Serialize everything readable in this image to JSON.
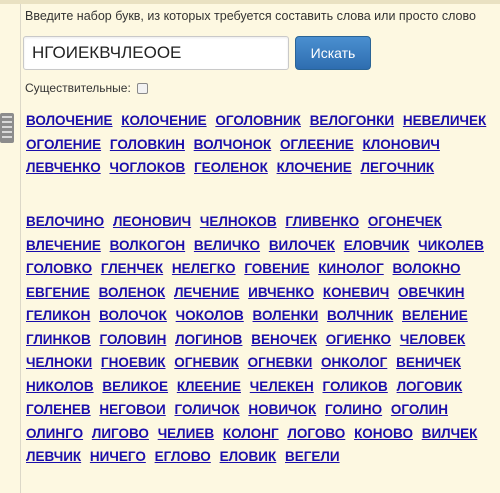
{
  "hint": "Введите набор букв, из которых требуется составить слова или просто слово",
  "search": {
    "value": "НГОИЕКВЧЛЕООЕ",
    "button_label": "Искать"
  },
  "noun_filter": {
    "label": "Существительные:",
    "checked": false
  },
  "colors": {
    "background": "#fdf8e1",
    "link": "#1a0dab",
    "button": "#337ab7"
  },
  "icons": {
    "binder": "binder-rings-icon"
  },
  "words_group_1": [
    "ВОЛОЧЕНИЕ",
    "КОЛОЧЕНИЕ",
    "ОГОЛОВНИК",
    "ВЕЛОГОНКИ",
    "НЕВЕЛИЧЕК",
    "ОГОЛЕНИЕ",
    "ГОЛОВКИН",
    "ВОЛЧОНОК",
    "ОГЛЕЕНИЕ",
    "КЛОНОВИЧ",
    "ЛЕВЧЕНКО",
    "ЧОГЛОКОВ",
    "ГЕОЛЕНОК",
    "КЛОЧЕНИЕ",
    "ЛЕГОЧНИК"
  ],
  "words_group_2": [
    "ВЕЛОЧИНО",
    "ЛЕОНОВИЧ",
    "ЧЕЛНОКОВ",
    "ГЛИВЕНКО",
    "ОГОНЕЧЕК",
    "ВЛЕЧЕНИЕ",
    "ВОЛКОГОН",
    "ВЕЛИЧКО",
    "ВИЛОЧЕК",
    "ЕЛОВЧИК",
    "ЧИКОЛЕВ",
    "ГОЛОВКО",
    "ГЛЕНЧЕК",
    "НЕЛЕГКО",
    "ГОВЕНИЕ",
    "КИНОЛОГ",
    "ВОЛОКНО",
    "ЕВГЕНИЕ",
    "ВОЛЕНОК",
    "ЛЕЧЕНИЕ",
    "ИВЧЕНКО",
    "КОНЕВИЧ",
    "ОВЕЧКИН",
    "ГЕЛИКОН",
    "ВОЛОЧОК",
    "ЧОКОЛОВ",
    "ВОЛЕНКИ",
    "ВОЛЧНИК",
    "ВЕЛЕНИЕ",
    "ГЛИНКОВ",
    "ГОЛОВИН",
    "ЛОГИНОВ",
    "ВЕНОЧЕК",
    "ОГИЕНКО",
    "ЧЕЛОВЕК",
    "ЧЕЛНОКИ",
    "ГНОЕВИК",
    "ОГНЕВИК",
    "ОГНЕВКИ",
    "ОНКОЛОГ",
    "ВЕНИЧЕК",
    "НИКОЛОВ",
    "ВЕЛИКОЕ",
    "КЛЕЕНИЕ",
    "ЧЕЛЕКЕН",
    "ГОЛИКОВ",
    "ЛОГОВИК",
    "ГОЛЕНЕВ",
    "НЕГОВОИ",
    "ГОЛИЧОК",
    "НОВИЧОК",
    "ГОЛИНО",
    "ОГОЛИН",
    "ОЛИНГО",
    "ЛИГОВО",
    "ЧЕЛИЕВ",
    "КОЛОНГ",
    "ЛОГОВО",
    "КОНОВО",
    "ВИЛЧЕК",
    "ЛЕВЧИК",
    "НИЧЕГО",
    "ЕГЛОВО",
    "ЕЛОВИК",
    "ВЕГЕЛИ"
  ]
}
